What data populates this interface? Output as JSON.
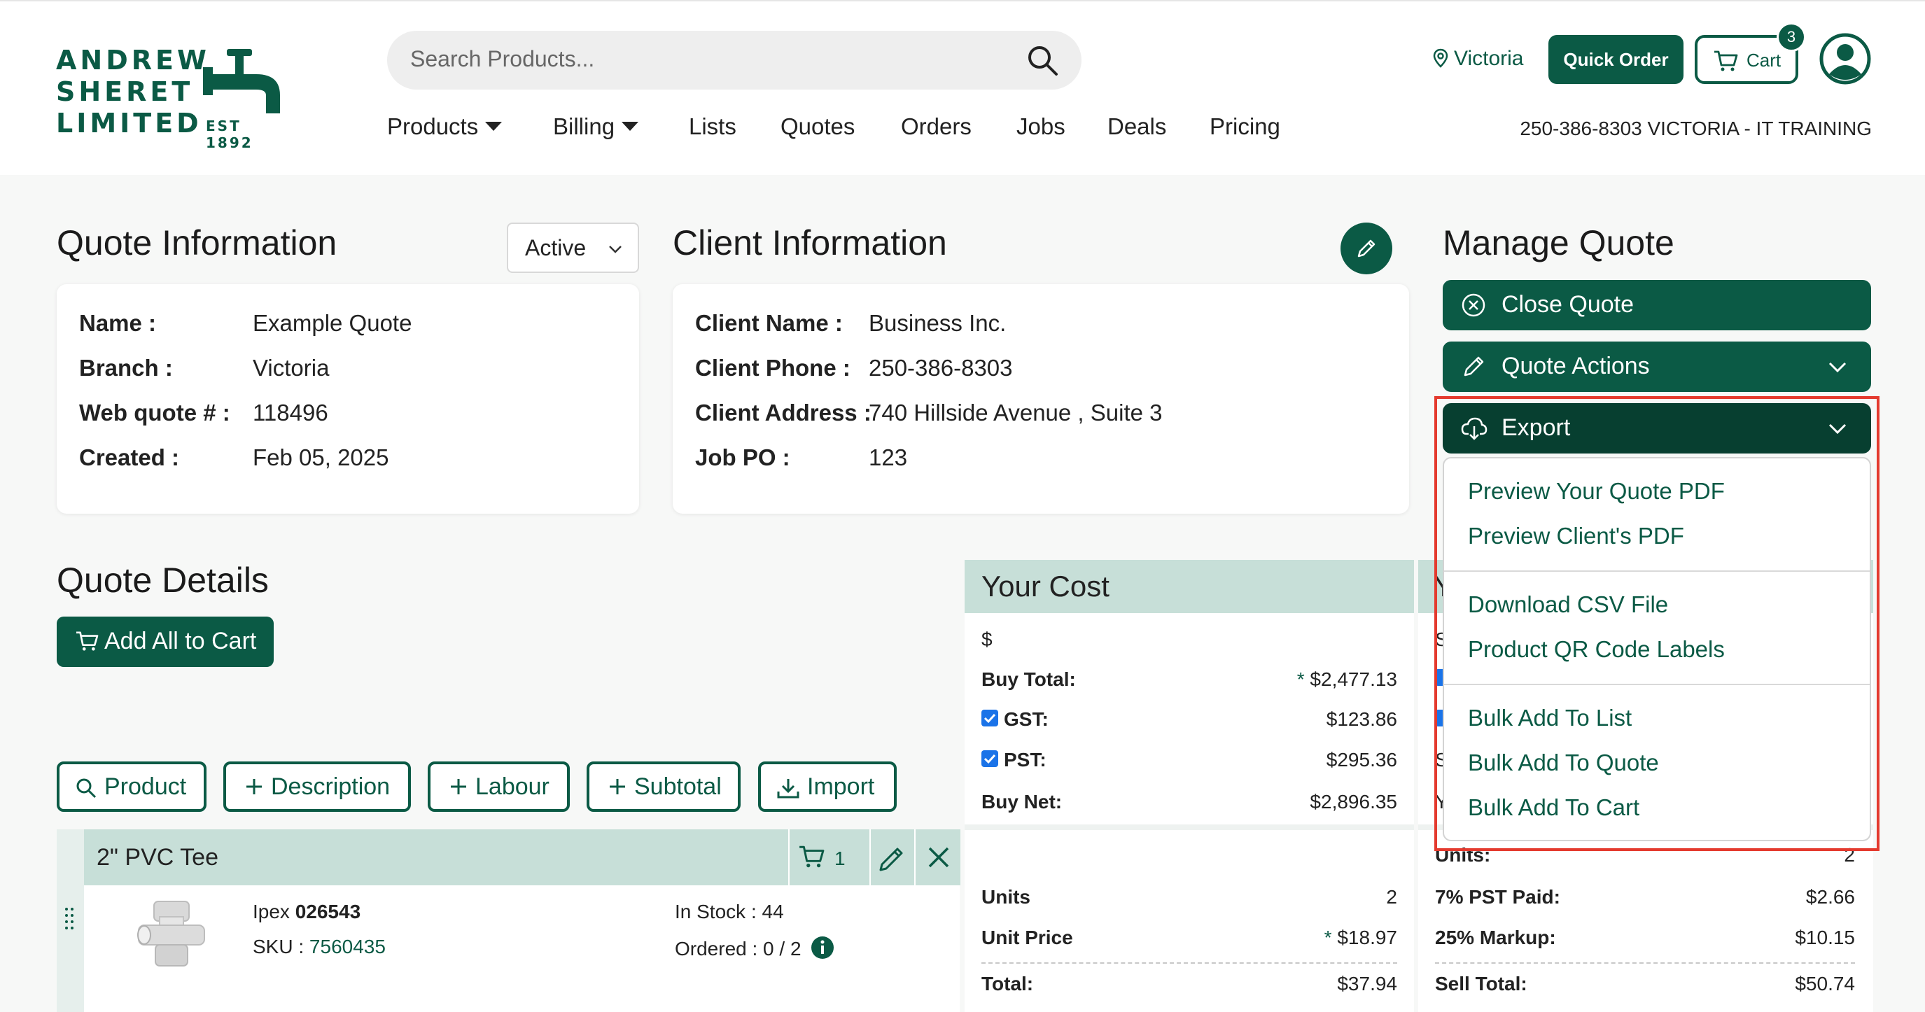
{
  "header": {
    "logo": {
      "line1": "ANDREW",
      "line2": "SHERET",
      "line3": "LIMITED",
      "est": "EST 1892"
    },
    "search_placeholder": "Search Products...",
    "nav": [
      "Products",
      "Billing",
      "Lists",
      "Quotes",
      "Orders",
      "Jobs",
      "Deals",
      "Pricing"
    ],
    "location": "Victoria",
    "quick_order": "Quick Order",
    "cart_label": "Cart",
    "cart_count": "3",
    "phone_line": "250-386-8303 VICTORIA - IT TRAINING"
  },
  "quote_info": {
    "title": "Quote Information",
    "status": "Active",
    "fields": [
      {
        "label": "Name :",
        "value": "Example Quote"
      },
      {
        "label": "Branch :",
        "value": "Victoria"
      },
      {
        "label": "Web quote # :",
        "value": "118496"
      },
      {
        "label": "Created :",
        "value": "Feb 05, 2025"
      }
    ]
  },
  "client_info": {
    "title": "Client Information",
    "fields": [
      {
        "label": "Client Name :",
        "value": "Business Inc."
      },
      {
        "label": "Client Phone :",
        "value": "250-386-8303"
      },
      {
        "label": "Client Address :",
        "value": "740 Hillside Avenue , Suite 3"
      },
      {
        "label": "Job PO :",
        "value": "123"
      }
    ]
  },
  "manage": {
    "title": "Manage Quote",
    "close_quote": "Close Quote",
    "quote_actions": "Quote Actions",
    "export": "Export",
    "export_menu": {
      "group1": [
        "Preview Your Quote PDF",
        "Preview Client's PDF"
      ],
      "group2": [
        "Download CSV File",
        "Product QR Code Labels"
      ],
      "group3": [
        "Bulk Add To List",
        "Bulk Add To Quote",
        "Bulk Add To Cart"
      ]
    }
  },
  "details": {
    "title": "Quote Details",
    "add_all": "Add All to Cart",
    "tools": [
      "Product",
      "Description",
      "Labour",
      "Subtotal",
      "Import"
    ]
  },
  "line_item": {
    "name": "2\" PVC Tee",
    "cart_qty": "1",
    "brand": "Ipex",
    "part": "026543",
    "sku_label": "SKU :",
    "sku": "7560435",
    "in_stock": "In Stock : 44",
    "ordered": "Ordered : 0 / 2"
  },
  "your_cost": {
    "title": "Your Cost",
    "currency": "$",
    "buy_total_label": "Buy Total:",
    "buy_total": "$2,477.13",
    "gst_label": "GST:",
    "gst": "$123.86",
    "pst_label": "PST:",
    "pst": "$295.36",
    "buy_net_label": "Buy Net:",
    "buy_net": "$2,896.35",
    "units_label": "Units",
    "units": "2",
    "unit_price_label": "Unit Price",
    "unit_price": "$18.97",
    "total_label": "Total:",
    "total": "$37.94",
    "star": "*"
  },
  "sell": {
    "head_partial": "Y",
    "row1_partial": "S",
    "row4_partial": "S",
    "row5_partial": "Y",
    "units_label": "Units:",
    "units": "2",
    "pst_paid_label": "7% PST Paid:",
    "pst_paid": "$2.66",
    "markup_label": "25% Markup:",
    "markup": "$10.15",
    "sell_total_label": "Sell Total:",
    "sell_total": "$50.74"
  },
  "colors": {
    "brand": "#0b5a45",
    "brand_dark": "#073f30",
    "panel_head": "#c7dfd8",
    "highlight": "#e43a2e"
  }
}
